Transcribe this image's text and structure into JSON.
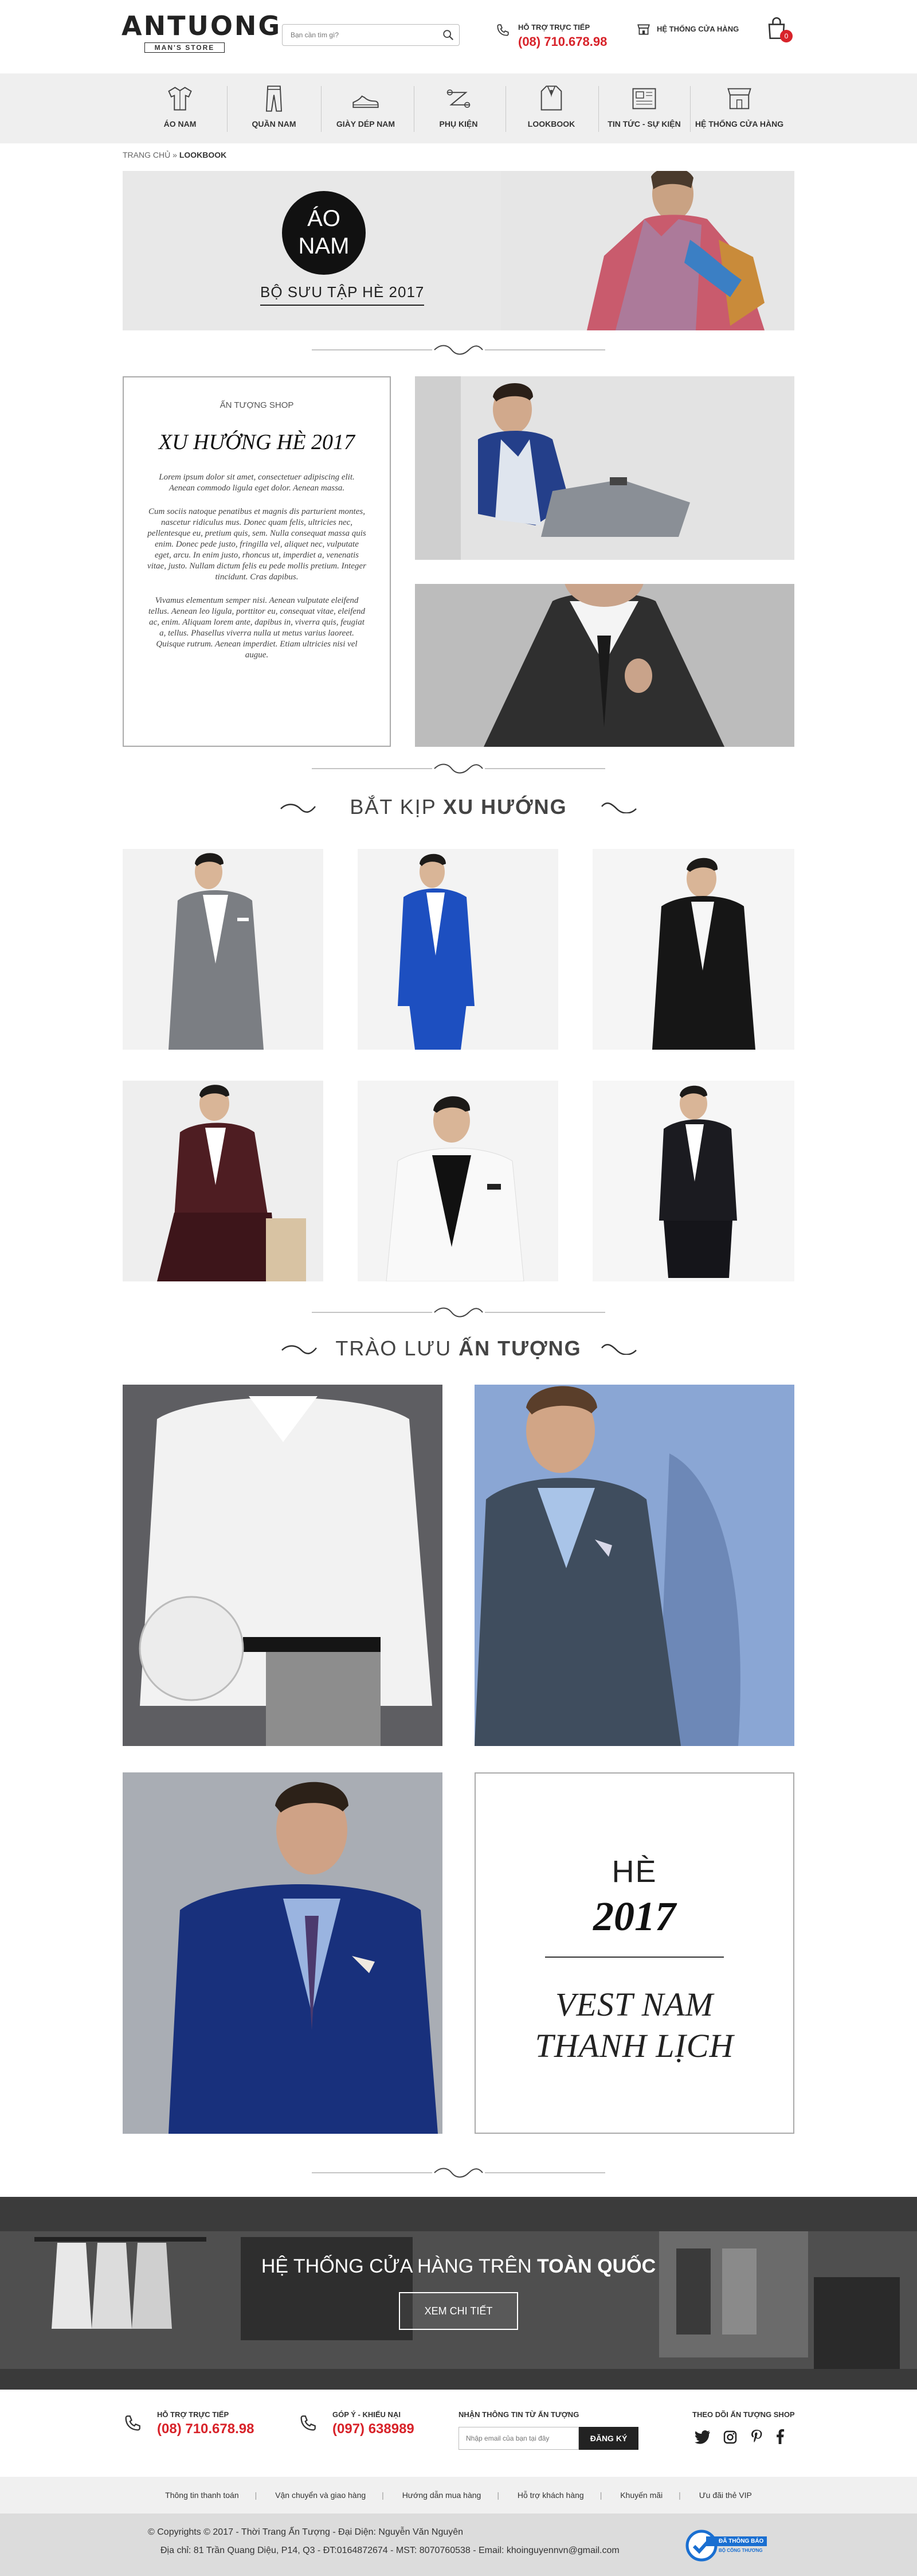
{
  "header": {
    "logo_main": "ANTUONG",
    "logo_sub": "MAN'S STORE",
    "search_placeholder": "Bạn cần tìm gì?",
    "support_label": "HỖ TRỢ TRỰC TIẾP",
    "support_phone": "(08) 710.678.98",
    "stores_label": "HỆ THỐNG CỬA HÀNG",
    "cart_count": "0"
  },
  "nav": {
    "items": [
      {
        "label": "ÁO NAM",
        "icon": "shirt-icon"
      },
      {
        "label": "QUẦN NAM",
        "icon": "trousers-icon"
      },
      {
        "label": "GIÀY DÉP NAM",
        "icon": "shoe-icon"
      },
      {
        "label": "PHỤ KIỆN",
        "icon": "tie-icon"
      },
      {
        "label": "LOOKBOOK",
        "icon": "suit-icon"
      },
      {
        "label": "TIN TỨC - SỰ KIỆN",
        "icon": "newspaper-icon"
      },
      {
        "label": "HỆ THỐNG CỬA HÀNG",
        "icon": "storefront-icon"
      }
    ]
  },
  "breadcrumb": {
    "home": "TRANG CHỦ",
    "sep": " » ",
    "current": "LOOKBOOK"
  },
  "hero": {
    "circle_line1": "ÁO",
    "circle_line2": "NAM",
    "subtitle": "BỘ SƯU TẬP HÈ 2017"
  },
  "intro": {
    "kicker": "ẤN TƯỢNG SHOP",
    "title": "XU HƯỚNG HÈ 2017",
    "p1": "Lorem ipsum dolor sit amet, consectetuer adipiscing elit. Aenean commodo ligula eget dolor. Aenean massa.",
    "p2": "Cum sociis natoque penatibus et magnis dis parturient montes, nascetur ridiculus mus. Donec quam felis, ultricies nec, pellentesque eu, pretium quis, sem. Nulla consequat massa quis enim. Donec pede justo, fringilla vel, aliquet nec, vulputate eget, arcu. In enim justo, rhoncus ut, imperdiet a, venenatis vitae, justo. Nullam dictum felis eu pede mollis pretium. Integer tincidunt. Cras dapibus.",
    "p3": "Vivamus elementum semper nisi. Aenean vulputate eleifend tellus. Aenean leo ligula, porttitor eu, consequat vitae, eleifend ac, enim. Aliquam lorem ante, dapibus in, viverra quis, feugiat a, tellus. Phasellus viverra nulla ut metus varius laoreet. Quisque rutrum. Aenean imperdiet. Etiam ultricies nisi vel augue."
  },
  "trend": {
    "title_light": "BẮT KỊP ",
    "title_bold": "XU HƯỚNG"
  },
  "impress": {
    "title_light": "TRÀO LƯU ",
    "title_bold": "ẤN TƯỢNG"
  },
  "promo": {
    "he": "HÈ",
    "year": "2017",
    "line1": "VEST NAM",
    "line2": "THANH LỊCH"
  },
  "banner": {
    "title_light": "HỆ THỐNG CỬA HÀNG TRÊN ",
    "title_bold": "TOÀN QUỐC",
    "button": "XEM CHI TIẾT"
  },
  "footer": {
    "support_label": "HỖ TRỢ TRỰC TIẾP",
    "support_phone": "(08) 710.678.98",
    "complaint_label": "GÓP Ý - KHIẾU NẠI",
    "complaint_phone": "(097) 638989",
    "newsletter_label": "NHẬN THÔNG TIN TỪ ẤN TƯỢNG",
    "newsletter_placeholder": "Nhập email của bạn tại đây",
    "newsletter_button": "ĐĂNG KÝ",
    "follow_label": "THEO DÕI ẤN TƯỢNG SHOP",
    "links": [
      "Thông tin thanh toán",
      "Vận chuyển và giao hàng",
      "Hướng dẫn mua hàng",
      "Hỗ trợ khách hàng",
      "Khuyến mãi",
      "Ưu đãi thẻ VIP"
    ],
    "copyright": "© Copyrights © 2017 - Thời Trang Ấn Tượng - Đại Diện: Nguyễn Văn Nguyên",
    "address": "Địa chỉ: 81 Trần Quang Diệu, P14, Q3 - ĐT:0164872674 - MST: 8070760538 - Email: khoinguyennvn@gmail.com",
    "badge_line1": "ĐÃ THÔNG BÁO",
    "badge_line2": "BỘ CÔNG THƯƠNG"
  },
  "colors": {
    "accent_red": "#d8232a",
    "nav_bg": "#efefef",
    "dark": "#222222"
  }
}
